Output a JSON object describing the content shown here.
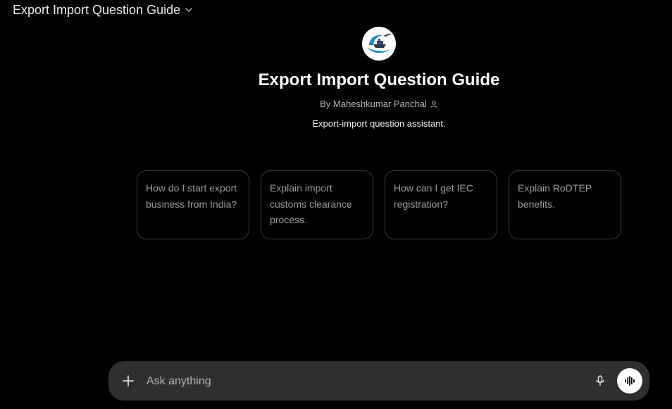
{
  "header": {
    "title": "Export Import Question Guide",
    "dropdown_icon": "chevron-down-icon"
  },
  "gpt": {
    "avatar_icon": "ship-plane-logo",
    "name": "Export Import Question Guide",
    "byline": "By Maheshkumar Panchal",
    "author_icon": "person-icon",
    "description": "Export-import question assistant."
  },
  "starters": [
    {
      "label": "How do I start export business from India?"
    },
    {
      "label": "Explain import customs clearance process."
    },
    {
      "label": "How can I get IEC registration?"
    },
    {
      "label": "Explain RoDTEP benefits."
    }
  ],
  "composer": {
    "placeholder": "Ask anything",
    "value": "",
    "plus_icon": "plus-icon",
    "mic_icon": "microphone-icon",
    "voice_icon": "voice-mode-icon"
  },
  "colors": {
    "background": "#000000",
    "composer": "#2f2f2f",
    "text": "#ececec",
    "muted": "#9b9b9b",
    "logo_blue": "#1e88c9"
  }
}
